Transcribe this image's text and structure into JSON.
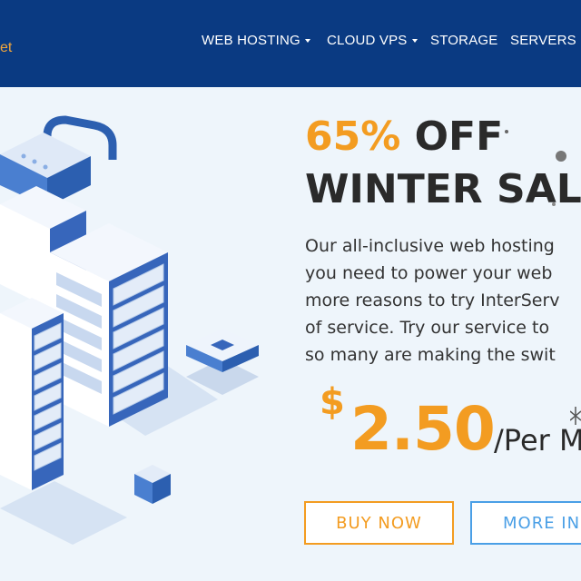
{
  "header": {
    "logo_fragment": "et",
    "menu": [
      {
        "label": "WEB HOSTING",
        "dropdown": true
      },
      {
        "label": "CLOUD VPS",
        "dropdown": true
      },
      {
        "label": "STORAGE",
        "dropdown": false
      },
      {
        "label": "SERVERS",
        "dropdown": true
      }
    ]
  },
  "hero": {
    "discount": "65%",
    "off": "OFF",
    "sale": "WINTER SALE",
    "description_lines": [
      "Our all-inclusive web hosting",
      "you need to power your web",
      "more reasons to try InterServ",
      "of service. Try our service to",
      "so many are making the swit"
    ],
    "price": {
      "currency": "$",
      "amount": "2.50",
      "period": "/Per M"
    },
    "buttons": {
      "buy": "BUY NOW",
      "more": "MORE INF"
    }
  },
  "colors": {
    "nav_bg": "#0a3a82",
    "accent": "#f39c21",
    "secondary": "#4a9fe6",
    "page_bg": "#eef5fb"
  }
}
